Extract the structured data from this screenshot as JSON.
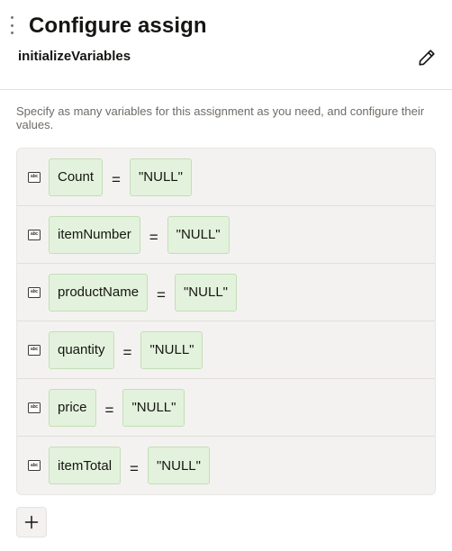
{
  "header": {
    "title": "Configure assign",
    "subtitle": "initializeVariables",
    "edit_icon": "pencil-icon",
    "drag_icon": "drag-handle-icon"
  },
  "description": "Specify as many variables for this assignment as you need, and configure their values.",
  "operator": "=",
  "variables": [
    {
      "name": "Count",
      "value": "\"NULL\"",
      "type_icon": "abc-string-icon",
      "type_label": "abc"
    },
    {
      "name": "itemNumber",
      "value": "\"NULL\"",
      "type_icon": "abc-string-icon",
      "type_label": "abc"
    },
    {
      "name": "productName",
      "value": "\"NULL\"",
      "type_icon": "abc-string-icon",
      "type_label": "abc"
    },
    {
      "name": "quantity",
      "value": "\"NULL\"",
      "type_icon": "abc-string-icon",
      "type_label": "abc"
    },
    {
      "name": "price",
      "value": "\"NULL\"",
      "type_icon": "abc-string-icon",
      "type_label": "abc"
    },
    {
      "name": "itemTotal",
      "value": "\"NULL\"",
      "type_icon": "abc-string-icon",
      "type_label": "abc"
    }
  ],
  "add_button": {
    "icon": "plus-icon",
    "label": "+"
  },
  "colors": {
    "token_bg": "#e3f2dc",
    "token_border": "#c3dfb6",
    "list_bg": "#f3f2f1",
    "description_text": "#6f6b66"
  }
}
